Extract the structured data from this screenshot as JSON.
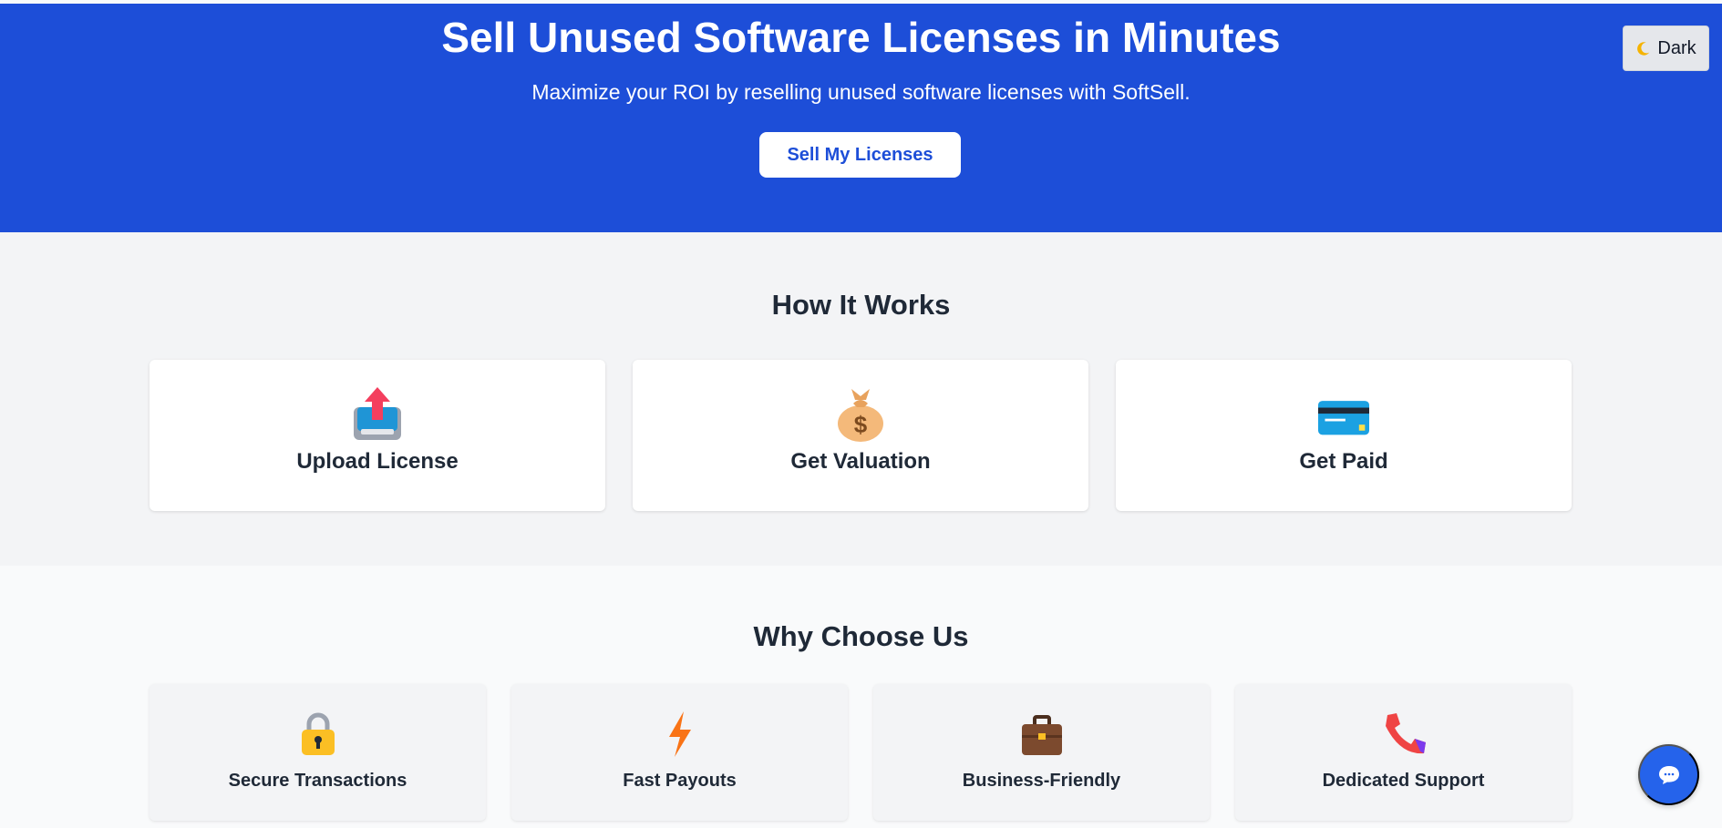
{
  "hero": {
    "title": "Sell Unused Software Licenses in Minutes",
    "subtitle": "Maximize your ROI by reselling unused software licenses with SoftSell.",
    "cta_label": "Sell My Licenses"
  },
  "theme_toggle": {
    "label": "Dark",
    "icon": "moon-icon"
  },
  "how_it_works": {
    "title": "How It Works",
    "steps": [
      {
        "label": "Upload License",
        "icon": "outbox-tray-icon"
      },
      {
        "label": "Get Valuation",
        "icon": "money-bag-icon"
      },
      {
        "label": "Get Paid",
        "icon": "credit-card-icon"
      }
    ]
  },
  "why_choose_us": {
    "title": "Why Choose Us",
    "items": [
      {
        "label": "Secure Transactions",
        "icon": "lock-icon"
      },
      {
        "label": "Fast Payouts",
        "icon": "lightning-icon"
      },
      {
        "label": "Business-Friendly",
        "icon": "briefcase-icon"
      },
      {
        "label": "Dedicated Support",
        "icon": "telephone-icon"
      }
    ]
  },
  "chat": {
    "icon": "chat-bubble-icon"
  },
  "colors": {
    "brand_blue": "#1d4ed8",
    "section_gray": "#f3f4f6",
    "page_bg": "#f9fafb",
    "text_dark": "#1f2937"
  }
}
